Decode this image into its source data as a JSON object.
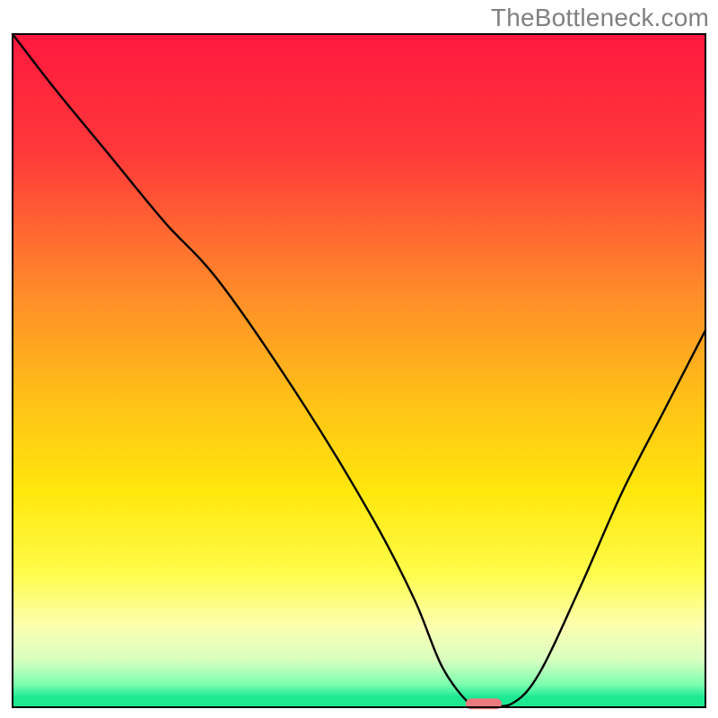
{
  "watermark": "TheBottleneck.com",
  "chart_data": {
    "type": "line",
    "title": "",
    "xlabel": "",
    "ylabel": "",
    "xlim": [
      0,
      100
    ],
    "ylim": [
      0,
      100
    ],
    "grid": false,
    "legend": false,
    "gradient_stops": [
      {
        "offset": 0.0,
        "color": "#ff183f"
      },
      {
        "offset": 0.18,
        "color": "#ff3a3a"
      },
      {
        "offset": 0.38,
        "color": "#ff8a2a"
      },
      {
        "offset": 0.55,
        "color": "#ffc316"
      },
      {
        "offset": 0.68,
        "color": "#ffe70c"
      },
      {
        "offset": 0.8,
        "color": "#fffc4a"
      },
      {
        "offset": 0.88,
        "color": "#fbffb0"
      },
      {
        "offset": 0.93,
        "color": "#d8ffc0"
      },
      {
        "offset": 0.965,
        "color": "#7fffb0"
      },
      {
        "offset": 0.985,
        "color": "#1de993"
      },
      {
        "offset": 1.0,
        "color": "#1de993"
      }
    ],
    "series": [
      {
        "name": "bottleneck-curve",
        "x": [
          0,
          6,
          14,
          22,
          30,
          42,
          52,
          58,
          62,
          66,
          68,
          72,
          76,
          82,
          88,
          94,
          100
        ],
        "y": [
          100,
          92,
          82,
          72,
          63,
          45,
          28,
          16,
          6,
          0.5,
          0.5,
          0.5,
          5,
          18,
          32,
          44,
          56
        ]
      }
    ],
    "marker": {
      "name": "optimal-marker",
      "x": 68,
      "y": 0.5,
      "width_pct": 5.2,
      "height_pct": 1.6,
      "color": "#ea7a7f"
    },
    "frame": {
      "stroke": "#000000",
      "stroke_width": 2
    }
  }
}
